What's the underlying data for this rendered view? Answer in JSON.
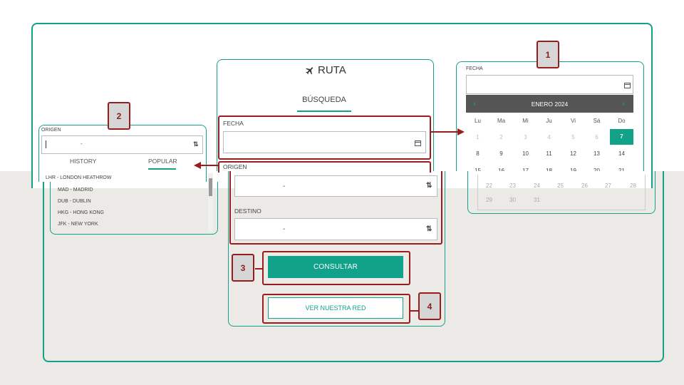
{
  "brand": {
    "title": "RUTA",
    "icon": "plane-icon"
  },
  "tabs": [
    {
      "label": "BÚSQUEDA",
      "active": true
    }
  ],
  "form": {
    "fecha_label": "FECHA",
    "origen_label": "ORIGEN",
    "origen_value": "-",
    "destino_label": "DESTINO",
    "destino_value": "-",
    "consultar_label": "CONSULTAR",
    "ver_red_label": "VER NUESTRA RED"
  },
  "calendar": {
    "label": "FECHA",
    "month": "ENERO 2024",
    "days_of_week": [
      "Lu",
      "Ma",
      "Mi",
      "Ju",
      "Vi",
      "Sá",
      "Do"
    ],
    "rows": [
      [
        "1",
        "2",
        "3",
        "4",
        "5",
        "6",
        "7"
      ],
      [
        "8",
        "9",
        "10",
        "11",
        "12",
        "13",
        "14"
      ],
      [
        "15",
        "16",
        "17",
        "18",
        "19",
        "20",
        "21"
      ],
      [
        "22",
        "23",
        "24",
        "25",
        "26",
        "27",
        "28"
      ],
      [
        "29",
        "30",
        "31"
      ]
    ],
    "selected": "7"
  },
  "dropdown": {
    "label": "ORIGEN",
    "value": "-",
    "tabs": [
      "HISTORY",
      "POPULAR"
    ],
    "active_tab": "POPULAR",
    "items": [
      "LHR - LONDON HEATHROW",
      "MAD - MADRID",
      "DUB - DUBLIN",
      "HKG - HONG KONG",
      "JFK - NEW YORK"
    ]
  },
  "callouts": [
    "1",
    "2",
    "3",
    "4"
  ],
  "colors": {
    "accent": "#12a28a",
    "callout": "#9b1c1c",
    "header": "#555555"
  }
}
